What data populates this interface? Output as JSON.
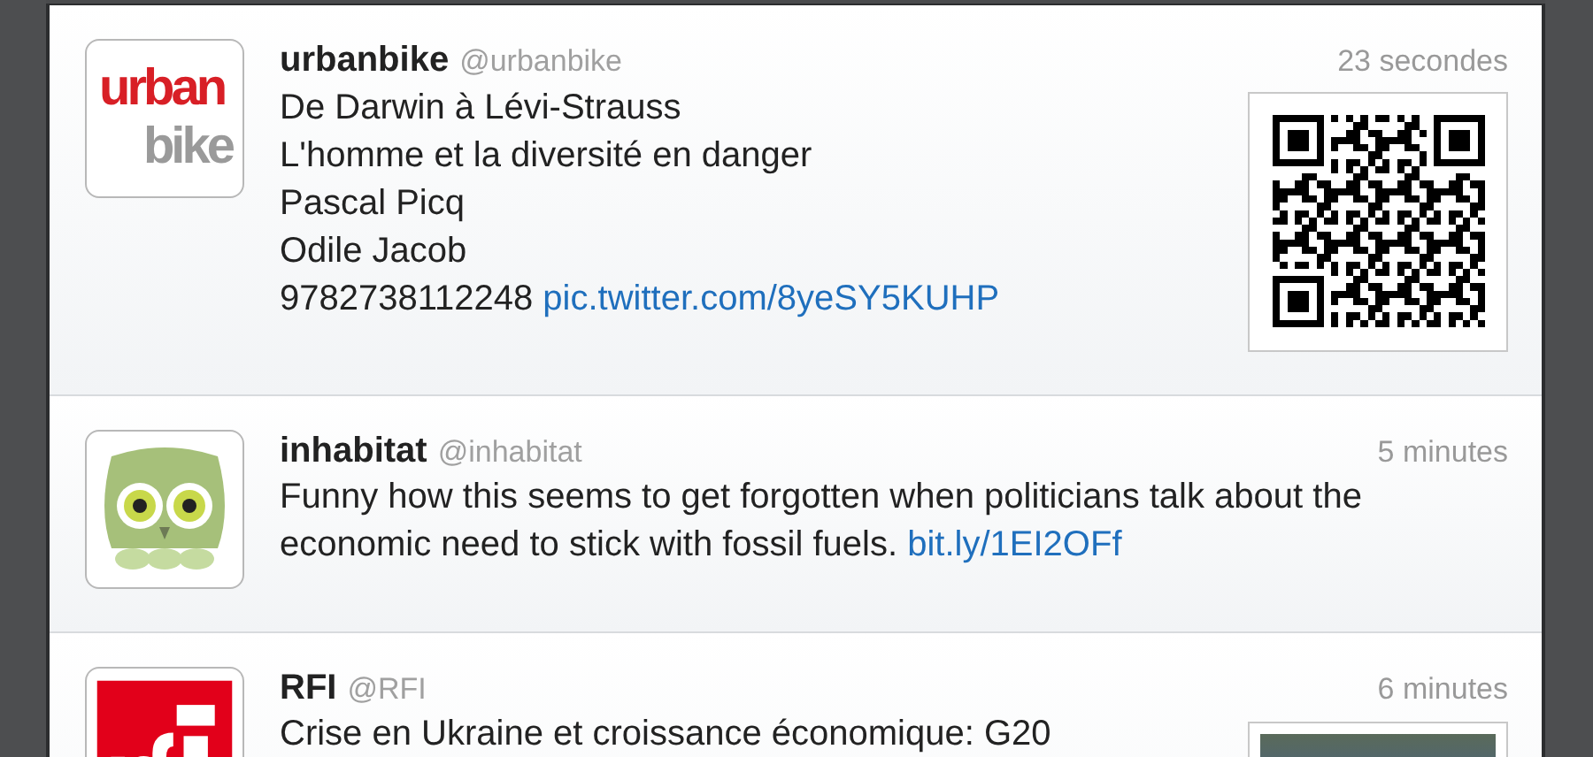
{
  "tweets": [
    {
      "name": "urbanbike",
      "handle": "@urbanbike",
      "time": "23 secondes",
      "avatar": {
        "kind": "urbanbike",
        "logo_text": [
          "urban",
          "bike"
        ]
      },
      "media": {
        "kind": "qr"
      },
      "body": [
        {
          "kind": "text",
          "text": "De Darwin à Lévi-Strauss\nL'homme et la diversité en danger\nPascal Picq\nOdile Jacob\n9782738112248 "
        },
        {
          "kind": "link",
          "text": "pic.twitter.com/8yeSY5KUHP"
        }
      ]
    },
    {
      "name": "inhabitat",
      "handle": "@inhabitat",
      "time": "5 minutes",
      "avatar": {
        "kind": "owl"
      },
      "body": [
        {
          "kind": "text",
          "text": "Funny how this seems to get forgotten when politicians talk about the economic need to stick with fossil fuels. "
        },
        {
          "kind": "link",
          "text": "bit.ly/1EI2OFf"
        }
      ]
    },
    {
      "name": "RFI",
      "handle": "@RFI",
      "time": "6 minutes",
      "avatar": {
        "kind": "rfi"
      },
      "media": {
        "kind": "photo"
      },
      "body": [
        {
          "kind": "text",
          "text": "Crise en Ukraine et croissance économique: G20"
        }
      ]
    }
  ]
}
